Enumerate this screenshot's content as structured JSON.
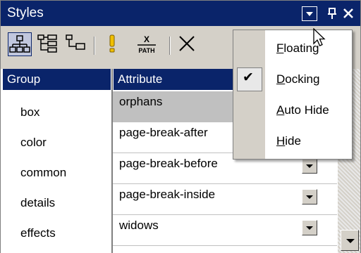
{
  "window": {
    "title": "Styles",
    "title_buttons": [
      "menu-dropdown",
      "pin",
      "close"
    ],
    "pin_glyph": "ᵖ",
    "close_glyph": "✕"
  },
  "toolbar": {
    "tools": [
      {
        "name": "tree-view-icon",
        "active": true
      },
      {
        "name": "expand-icon"
      },
      {
        "name": "collapse-icon"
      },
      {
        "name": "important-icon"
      },
      {
        "name": "xpath-icon",
        "label_top": "X",
        "label_bottom": "PATH"
      },
      {
        "name": "delete-icon"
      }
    ]
  },
  "grid": {
    "headers": {
      "group": "Group",
      "attribute": "Attribute"
    },
    "groups": [
      "box",
      "color",
      "common",
      "details",
      "effects"
    ],
    "attributes": [
      {
        "name": "orphans",
        "selected": true
      },
      {
        "name": "page-break-after"
      },
      {
        "name": "page-break-before"
      },
      {
        "name": "page-break-inside"
      },
      {
        "name": "widows"
      }
    ]
  },
  "menu": {
    "items": [
      {
        "label_underline": "F",
        "label_rest": "loating",
        "checked": false
      },
      {
        "label_underline": "D",
        "label_rest": "ocking",
        "checked": true
      },
      {
        "label_underline": "A",
        "label_rest": "uto Hide",
        "checked": false
      },
      {
        "label_underline": "H",
        "label_rest": "ide",
        "checked": false
      }
    ],
    "check_glyph": "✔"
  },
  "colors": {
    "titlebar": "#0a246a",
    "face": "#d4d0c8",
    "selected_row": "#c0c0c0"
  }
}
